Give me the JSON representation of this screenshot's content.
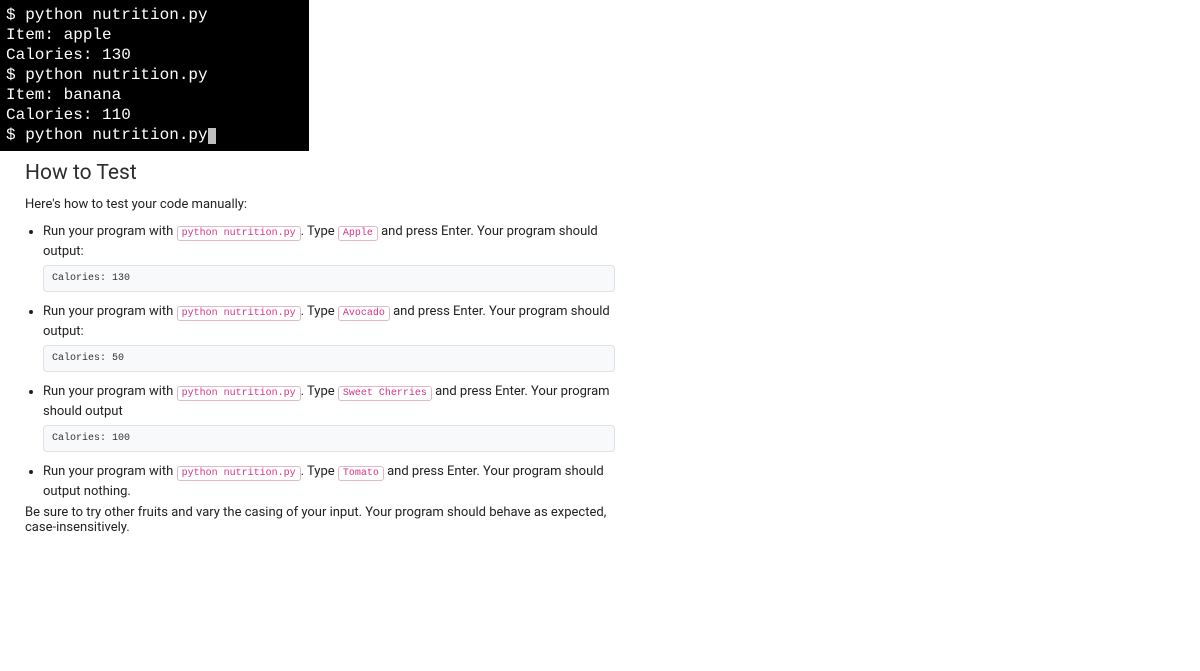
{
  "terminal": {
    "lines": [
      "$ python nutrition.py",
      "Item: apple",
      "Calories: 130",
      "$ python nutrition.py",
      "Item: banana",
      "Calories: 110",
      "$ python nutrition.py"
    ]
  },
  "heading": "How to Test",
  "intro": "Here's how to test your code manually:",
  "tests": [
    {
      "pre_text": "Run your program with ",
      "cmd": "python nutrition.py",
      "mid_text": ". Type ",
      "input": "Apple",
      "post_text": " and press Enter. Your program should output:",
      "output": "Calories: 130"
    },
    {
      "pre_text": "Run your program with ",
      "cmd": "python nutrition.py",
      "mid_text": ". Type ",
      "input": "Avocado",
      "post_text": " and press Enter. Your program should output:",
      "output": "Calories: 50"
    },
    {
      "pre_text": "Run your program with ",
      "cmd": "python nutrition.py",
      "mid_text": ". Type ",
      "input": "Sweet Cherries",
      "post_text": " and press Enter. Your program should output",
      "output": "Calories: 100"
    },
    {
      "pre_text": "Run your program with ",
      "cmd": "python nutrition.py",
      "mid_text": ". Type ",
      "input": "Tomato",
      "post_text": " and press Enter. Your program should output nothing.",
      "output": null
    }
  ],
  "footer": "Be sure to try other fruits and vary the casing of your input. Your program should behave as expected, case-insensitively."
}
